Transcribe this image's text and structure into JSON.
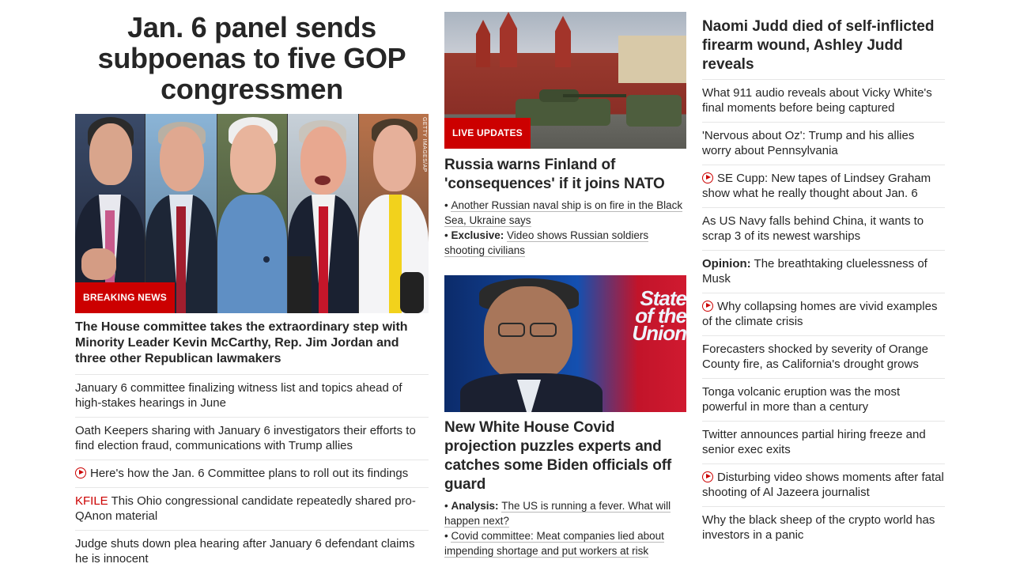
{
  "hero": {
    "title": "Jan. 6 panel sends subpoenas to five GOP congressmen",
    "image_credit": "GETTY IMAGES/AP",
    "badge": "BREAKING NEWS",
    "description": "The House committee takes the extraordinary step with Minority Leader Kevin McCarthy, Rep. Jim Jordan and three other Republican lawmakers"
  },
  "col1_list": [
    {
      "text": "January 6 committee finalizing witness list and topics ahead of high-stakes hearings in June"
    },
    {
      "text": "Oath Keepers sharing with January 6 investigators their efforts to find election fraud, communications with Trump allies"
    },
    {
      "text": "Here's how the Jan. 6 Committee plans to roll out its findings",
      "icon": "play-icon"
    },
    {
      "prefix": "KFILE",
      "text": " This Ohio congressional candidate repeatedly shared pro-QAnon material"
    },
    {
      "text": "Judge shuts down plea hearing after January 6 defendant claims he is innocent"
    }
  ],
  "russia": {
    "badge": "LIVE UPDATES",
    "title": "Russia warns Finland of 'consequences' if it joins NATO",
    "bullets": [
      {
        "prefix": "",
        "text": "Another Russian naval ship is on fire in the Black Sea, Ukraine says"
      },
      {
        "prefix": "Exclusive:",
        "text": "Video shows Russian soldiers shooting civilians"
      }
    ]
  },
  "covid": {
    "tv_logo": "State of the Union",
    "title": "New White House Covid projection puzzles experts and catches some Biden officials off guard",
    "bullets": [
      {
        "prefix": "Analysis:",
        "text": "The US is running a fever. What will happen next?"
      },
      {
        "prefix": "",
        "text": "Covid committee: Meat companies lied about impending shortage and put workers at risk"
      }
    ]
  },
  "col3": {
    "title": "Naomi Judd died of self-inflicted firearm wound, Ashley Judd reveals",
    "items": [
      {
        "text": "What 911 audio reveals about Vicky White's final moments before being captured"
      },
      {
        "text": "'Nervous about Oz': Trump and his allies worry about Pennsylvania"
      },
      {
        "text": "SE Cupp: New tapes of Lindsey Graham show what he really thought about Jan. 6",
        "icon": "play-icon"
      },
      {
        "text": "As US Navy falls behind China, it wants to scrap 3 of its newest warships"
      },
      {
        "prefix": "Opinion:",
        "text": " The breathtaking cluelessness of Musk"
      },
      {
        "text": "Why collapsing homes are vivid examples of the climate crisis",
        "icon": "play-icon"
      },
      {
        "text": "Forecasters shocked by severity of Orange County fire, as California's drought grows"
      },
      {
        "text": "Tonga volcanic eruption was the most powerful in more than a century"
      },
      {
        "text": "Twitter announces partial hiring freeze and senior exec exits"
      },
      {
        "text": "Disturbing video shows moments after fatal shooting of Al Jazeera journalist",
        "icon": "play-icon"
      },
      {
        "text": "Why the black sheep of the crypto world has investors in a panic"
      }
    ]
  },
  "colors": {
    "accent": "#cc0000",
    "text": "#262626",
    "divider": "#e6e6e6"
  }
}
